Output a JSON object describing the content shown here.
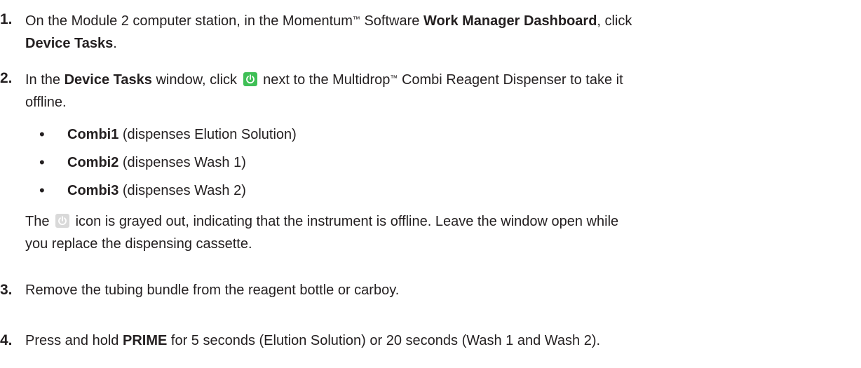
{
  "steps": [
    {
      "number": "1.",
      "line1_a": "On the Module 2 computer station, in the Momentum",
      "line1_tm": "™",
      "line1_b": " Software ",
      "line1_bold": "Work Manager Dashboard",
      "line1_c": ", click",
      "line2_bold": "Device Tasks",
      "line2_c": "."
    },
    {
      "number": "2.",
      "line1_a": "In the ",
      "line1_bold": "Device Tasks",
      "line1_b": " window, click",
      "line1_c": "next to the Multidrop",
      "line1_tm": "™",
      "line1_d": " Combi Reagent Dispenser to take it",
      "line2": "offline.",
      "bullets": [
        {
          "bold": "Combi1",
          "text": " (dispenses Elution Solution)"
        },
        {
          "bold": "Combi2",
          "text": " (dispenses Wash 1)"
        },
        {
          "bold": "Combi3",
          "text": " (dispenses Wash 2)"
        }
      ],
      "note_a": "The",
      "note_b": "icon is grayed out, indicating that the instrument is offline. Leave the window open while",
      "note_line2": "you replace the dispensing cassette."
    },
    {
      "number": "3.",
      "text": "Remove the tubing bundle from the reagent bottle or carboy."
    },
    {
      "number": "4.",
      "text_a": "Press and hold ",
      "bold": "PRIME",
      "text_b": " for 5 seconds (Elution Solution) or 20 seconds (Wash 1 and Wash 2)."
    }
  ],
  "bullet_glyph": "•",
  "icons": {
    "power_active": "power-icon",
    "power_inactive": "power-icon-grayed",
    "active_color": "#3fbf56",
    "inactive_color": "#d9d9d9"
  }
}
